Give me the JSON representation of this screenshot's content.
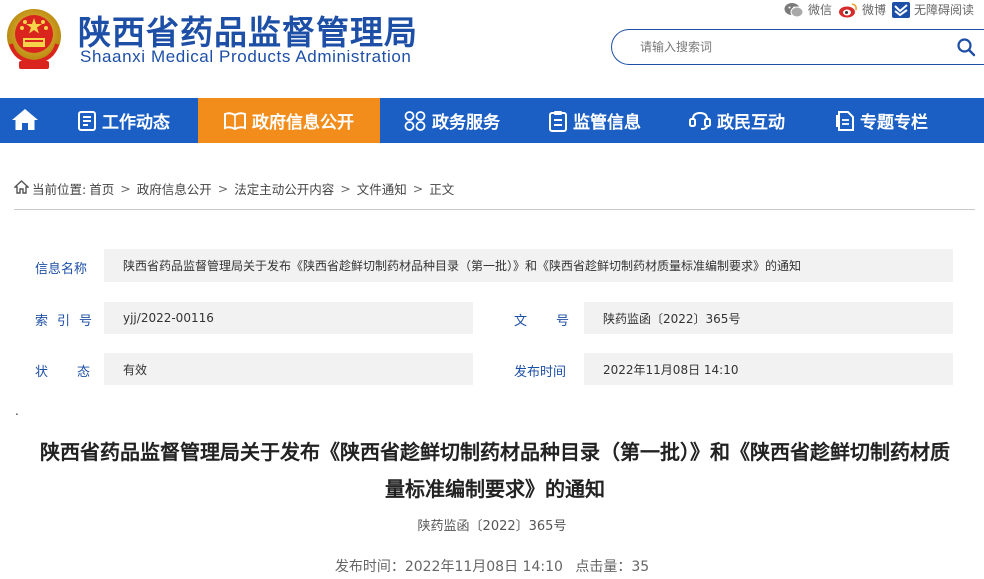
{
  "header": {
    "title_cn": "陕西省药品监督管理局",
    "title_en": "Shaanxi Medical Products Administration",
    "top_links": [
      {
        "label": "微信",
        "icon": "wechat-icon"
      },
      {
        "label": "微博",
        "icon": "weibo-icon"
      },
      {
        "label": "无障碍阅读",
        "icon": "accessibility-icon"
      }
    ],
    "search": {
      "placeholder": "请输入搜索词",
      "value": ""
    }
  },
  "nav": {
    "home_icon": "home-icon",
    "items": [
      {
        "label": "工作动态",
        "icon": "list-icon"
      },
      {
        "label": "政府信息公开",
        "icon": "book-icon"
      },
      {
        "label": "政务服务",
        "icon": "grid-icon"
      },
      {
        "label": "监管信息",
        "icon": "clipboard-icon"
      },
      {
        "label": "政民互动",
        "icon": "interaction-icon"
      },
      {
        "label": "专题专栏",
        "icon": "document-icon"
      }
    ],
    "active_index": 1
  },
  "breadcrumb": {
    "prefix": "当前位置:",
    "items": [
      "首页",
      "政府信息公开",
      "法定主动公开内容",
      "文件通知",
      "正文"
    ]
  },
  "info": {
    "name_label": "信息名称",
    "name_value": "陕西省药品监督管理局关于发布《陕西省趁鲜切制药材品种目录（第一批）》和《陕西省趁鲜切制药材质量标准编制要求》的通知",
    "index_label": "索引号",
    "index_value": "yjj/2022-00116",
    "docno_label": "文号",
    "docno_value": "陕药监函〔2022〕365号",
    "status_label": "状态",
    "status_value": "有效",
    "date_label": "发布时间",
    "date_value": "2022年11月08日 14:10"
  },
  "stray_mark": ".",
  "article": {
    "title": "陕西省药品监督管理局关于发布《陕西省趁鲜切制药材品种目录（第一批）》和《陕西省趁鲜切制药材质量标准编制要求》的通知",
    "doc_number": "陕药监函〔2022〕365号",
    "publish_time": "发布时间：2022年11月08日 14:10",
    "clicks": "点击量：35"
  },
  "colors": {
    "brand_blue": "#1d4fa7",
    "nav_blue": "#1b5fc4",
    "nav_active": "#f28c1a"
  }
}
